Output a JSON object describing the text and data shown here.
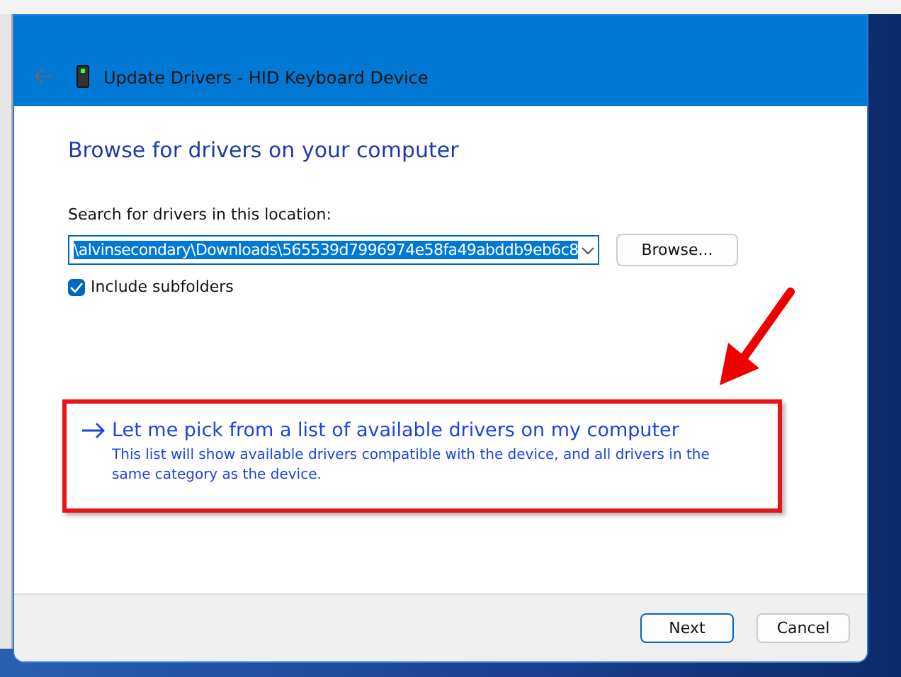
{
  "window": {
    "title": "Update Drivers - HID Keyboard Device"
  },
  "heading": "Browse for drivers on your computer",
  "search": {
    "label": "Search for drivers in this location:",
    "value": "\\alvinsecondary\\Downloads\\565539d7996974e58fa49abddb9eb6c8",
    "browse_button": "Browse..."
  },
  "include_subfolders": {
    "label": "Include subfolders",
    "checked": true
  },
  "pick_option": {
    "title": "Let me pick from a list of available drivers on my computer",
    "description": "This list will show available drivers compatible with the device, and all drivers in the same category as the device.",
    "highlighted": true
  },
  "buttons": [
    {
      "label": "Next",
      "default": true
    },
    {
      "label": "Cancel",
      "default": false
    }
  ]
}
